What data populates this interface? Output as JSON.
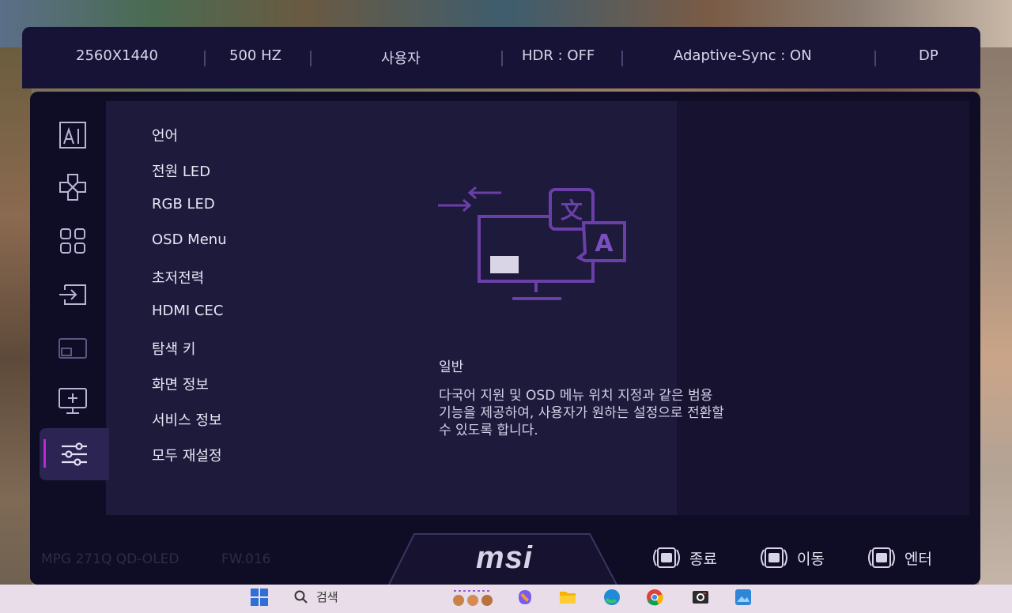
{
  "status_bar": {
    "resolution": "2560X1440",
    "refresh": "500 HZ",
    "profile": "사용자",
    "hdr": "HDR : OFF",
    "adaptive_sync": "Adaptive-Sync : ON",
    "input": "DP"
  },
  "icon_rail": [
    {
      "name": "ai-icon",
      "active": false
    },
    {
      "name": "gaming-dpad-icon",
      "active": false
    },
    {
      "name": "apps-grid-icon",
      "active": false
    },
    {
      "name": "input-source-icon",
      "active": false
    },
    {
      "name": "pip-icon",
      "active": false
    },
    {
      "name": "display-settings-icon",
      "active": false
    },
    {
      "name": "settings-sliders-icon",
      "active": true
    }
  ],
  "menu": {
    "items": [
      {
        "label": "언어"
      },
      {
        "label": "전원 LED"
      },
      {
        "label": "RGB LED"
      },
      {
        "label": "OSD Menu"
      },
      {
        "label": "초저전력"
      },
      {
        "label": "HDMI CEC"
      },
      {
        "label": "탐색 키"
      },
      {
        "label": "화면 정보"
      },
      {
        "label": "서비스 정보"
      },
      {
        "label": "모두 재설정"
      }
    ]
  },
  "description": {
    "title": "일반",
    "lines": [
      "다국어 지원 및 OSD 메뉴 위치 지정과 같은 범용",
      "기능을 제공하여, 사용자가 원하는 설정으로 전환할",
      "수 있도록 합니다."
    ]
  },
  "footer": {
    "model": "MPG 271Q QD-OLED",
    "firmware": "FW.016",
    "logo": "msi",
    "buttons": [
      {
        "label": "종료",
        "icon": "joystick-exit-icon"
      },
      {
        "label": "이동",
        "icon": "joystick-move-icon"
      },
      {
        "label": "엔터",
        "icon": "joystick-enter-icon"
      }
    ]
  },
  "taskbar": {
    "search_label": "검색",
    "apps": [
      "windows-start-icon",
      "search-icon",
      "widgets-icon",
      "copilot-icon",
      "file-explorer-icon",
      "edge-icon",
      "chrome-icon",
      "camera-app-icon",
      "photos-icon"
    ]
  },
  "colors": {
    "accent": "#c026d3",
    "illustration": "#6b3fa8",
    "panel": "#0f0c26"
  }
}
